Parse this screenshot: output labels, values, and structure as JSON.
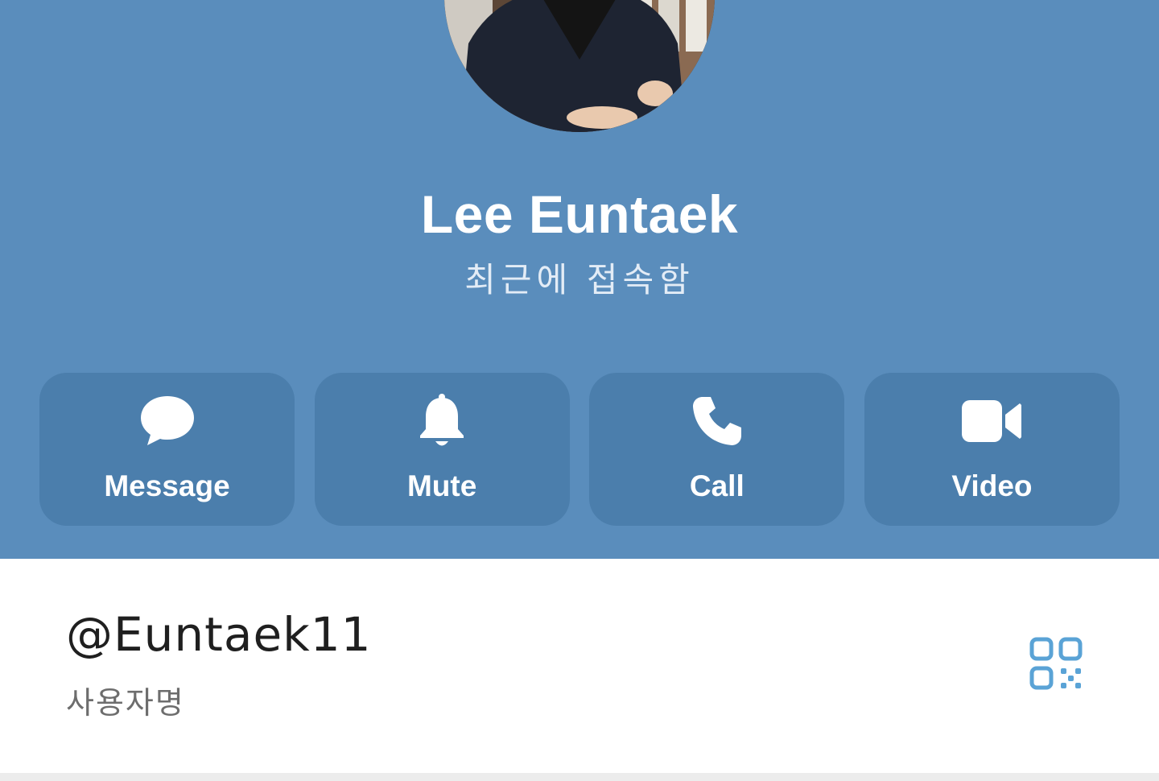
{
  "profile": {
    "name": "Lee Euntaek",
    "status": "최근에 접속함"
  },
  "actions": [
    {
      "label": "Message",
      "icon": "message-bubble-icon"
    },
    {
      "label": "Mute",
      "icon": "bell-icon"
    },
    {
      "label": "Call",
      "icon": "phone-icon"
    },
    {
      "label": "Video",
      "icon": "video-camera-icon"
    }
  ],
  "info": {
    "username": "@Euntaek11",
    "username_caption": "사용자명",
    "qr_icon": "qr-code-icon"
  },
  "colors": {
    "header_bg": "#5a8dbc",
    "action_bg": "#4b7eac",
    "accent": "#5aa3d6"
  }
}
